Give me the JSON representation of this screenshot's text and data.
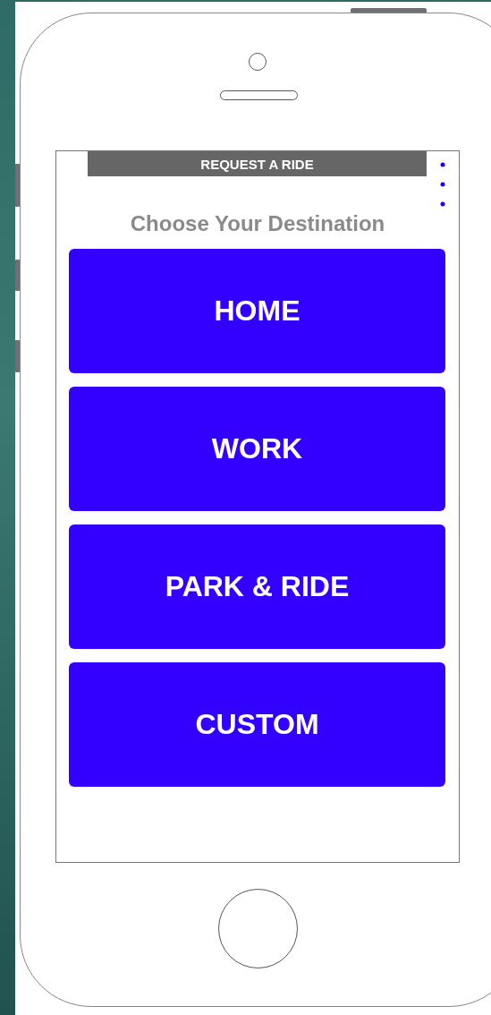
{
  "header": {
    "title": "REQUEST A RIDE"
  },
  "heading": "Choose Your Destination",
  "destinations": [
    {
      "label": "HOME"
    },
    {
      "label": "WORK"
    },
    {
      "label": "PARK & RIDE"
    },
    {
      "label": "CUSTOM"
    }
  ]
}
